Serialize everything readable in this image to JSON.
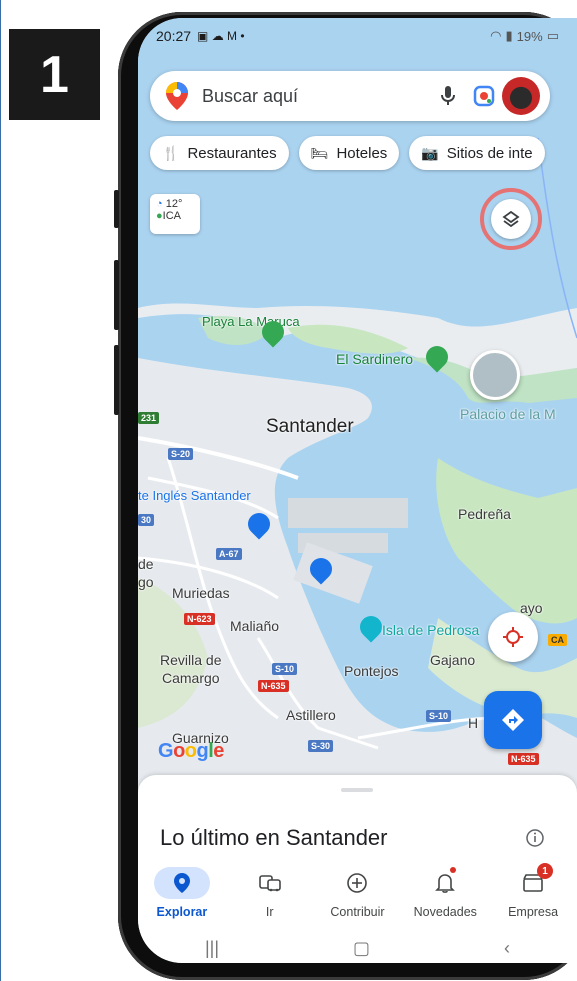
{
  "step": {
    "number": "1"
  },
  "status_bar": {
    "time": "20:27",
    "indicators": "▣ ☁ M •",
    "battery": "19%"
  },
  "search": {
    "placeholder": "Buscar aquí"
  },
  "chips": [
    {
      "label": "Restaurantes",
      "icon": "fork-knife-icon"
    },
    {
      "label": "Hoteles",
      "icon": "bed-icon"
    },
    {
      "label": "Sitios de inte",
      "icon": "camera-icon"
    }
  ],
  "weather": {
    "temp": "12°",
    "aqi": "ICA"
  },
  "map": {
    "labels": {
      "santander": "Santander",
      "playa_la_maruca": "Playa La Maruca",
      "el_sardinero": "El Sardinero",
      "palacio": "Palacio de la M",
      "pedrena": "Pedreña",
      "corte_ingles": "te Inglés Santander",
      "muriedas": "Muriedas",
      "maliano": "Maliaño",
      "revilla": "Revilla de",
      "camargo": "Camargo",
      "pontejos": "Pontejos",
      "gajano": "Gajano",
      "astillero": "Astillero",
      "guarnizo": "Guarnizo",
      "isla_pedrosa": "Isla de Pedrosa",
      "de": "de",
      "go": "go",
      "ayo": "ayo",
      "h": "H",
      "road_s20": "S-20",
      "road_231": "231",
      "road_30": "30",
      "road_a67": "A-67",
      "road_n623": "N-623",
      "road_s10": "S-10",
      "road_n635": "N-635",
      "road_s30": "S-30",
      "road_s10b": "S-10",
      "road_ca": "CA",
      "road_n": "N-635"
    }
  },
  "google_logo": "Google",
  "sheet": {
    "title": "Lo último en Santander"
  },
  "nav": [
    {
      "label": "Explorar"
    },
    {
      "label": "Ir"
    },
    {
      "label": "Contribuir"
    },
    {
      "label": "Novedades"
    },
    {
      "label": "Empresa",
      "badge": "1"
    }
  ],
  "colors": {
    "accent": "#1a73e8",
    "highlight_ring": "#e57373",
    "water": "#aad3f0",
    "land": "#e8ecef",
    "park": "#bfe3c4"
  }
}
